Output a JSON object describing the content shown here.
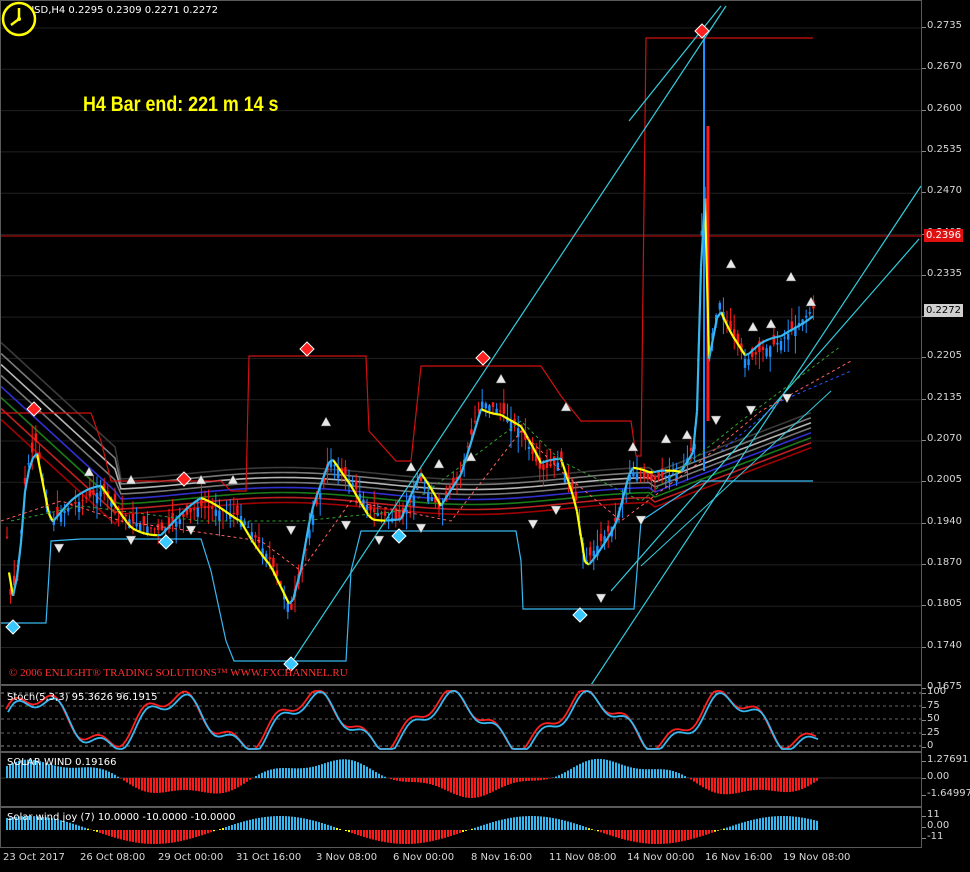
{
  "main": {
    "symbol_line": "XRPUSD,H4  0.2295 0.2309 0.2271 0.2272",
    "timer": "H4 Bar end: 221 m 14 s",
    "copyright": "© 2006 ENLIGHT® TRADING SOLUTIONS™ WWW.FXCHANNEL.RU",
    "price_ticks": [
      "0.2735",
      "0.2670",
      "0.2600",
      "0.2535",
      "0.2470",
      "0.2405",
      "0.2335",
      "0.2270",
      "0.2205",
      "0.2135",
      "0.2070",
      "0.2005",
      "0.1940",
      "0.1870",
      "0.1805",
      "0.1740",
      "0.1675"
    ],
    "red_line_price": "0.2396",
    "last_price": "0.2272",
    "colors": {
      "bull": "#1e90ff",
      "bear": "#ff1a1a",
      "line_red": "#d01010",
      "cyan": "#33ccdd",
      "yellow": "#ffff00",
      "sky": "#38b8f0"
    }
  },
  "stoch": {
    "label": "Stoch(5,3,3) 95.3626 96.1915",
    "ticks": [
      "100",
      "75",
      "50",
      "25",
      "0"
    ]
  },
  "solar": {
    "label": "SOLAR WIND 0.19166",
    "ticks": [
      "1.27691",
      "0.00",
      "-1.64997"
    ]
  },
  "joy": {
    "label": "Solar wind joy (7) 10.0000 -10.0000 -10.0000",
    "ticks": [
      "11",
      "0.00",
      "-11"
    ]
  },
  "time_labels": [
    "23 Oct 2017",
    "26 Oct 08:00",
    "29 Oct 00:00",
    "31 Oct 16:00",
    "3 Nov 08:00",
    "6 Nov 00:00",
    "8 Nov 16:00",
    "11 Nov 08:00",
    "14 Nov 00:00",
    "16 Nov 16:00",
    "19 Nov 08:00"
  ]
}
